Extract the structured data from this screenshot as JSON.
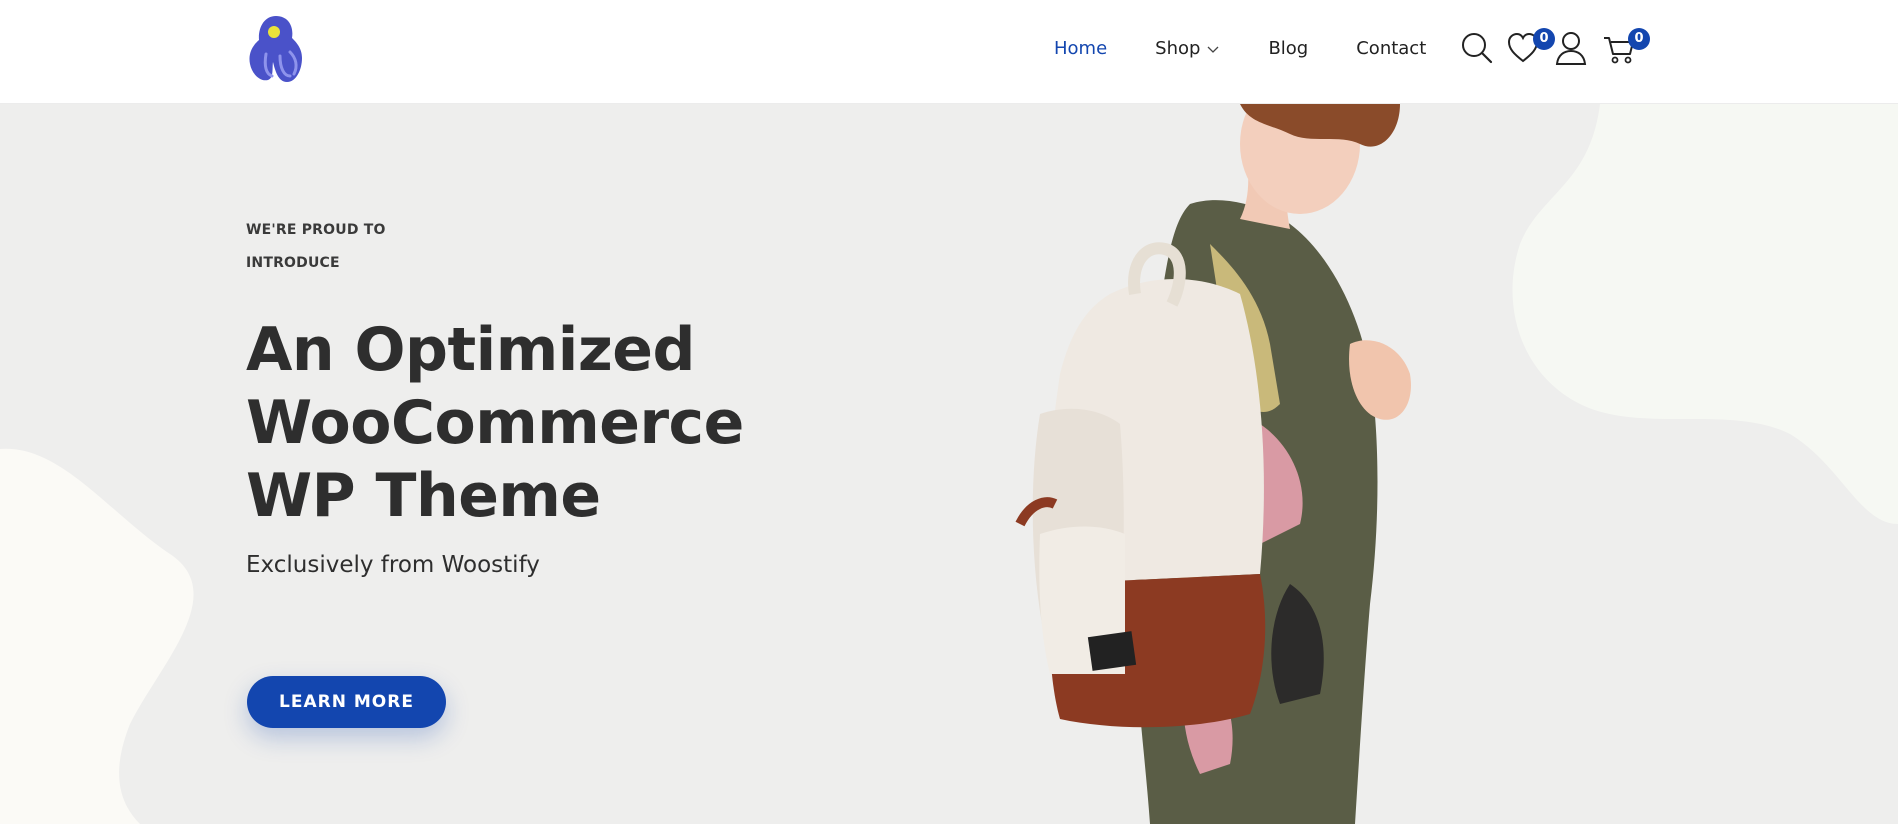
{
  "header": {
    "nav": [
      {
        "label": "Home",
        "active": true
      },
      {
        "label": "Shop",
        "dropdown": true
      },
      {
        "label": "Blog"
      },
      {
        "label": "Contact"
      }
    ],
    "wishlist_count": "0",
    "cart_count": "0"
  },
  "hero": {
    "eyebrow_line1": "WE'RE PROUD TO",
    "eyebrow_line2": "INTRODUCE",
    "headline_line1": "An Optimized",
    "headline_line2": "WooCommerce",
    "headline_line3": "WP Theme",
    "subtitle": "Exclusively from Woostify",
    "cta_label": "LEARN MORE"
  },
  "colors": {
    "accent": "#1346af",
    "hero_bg": "#eeeeed",
    "text": "#2e2e2e"
  },
  "icons": [
    "logo-mark",
    "chevron-down-icon",
    "search-icon",
    "heart-icon",
    "user-icon",
    "cart-icon"
  ]
}
